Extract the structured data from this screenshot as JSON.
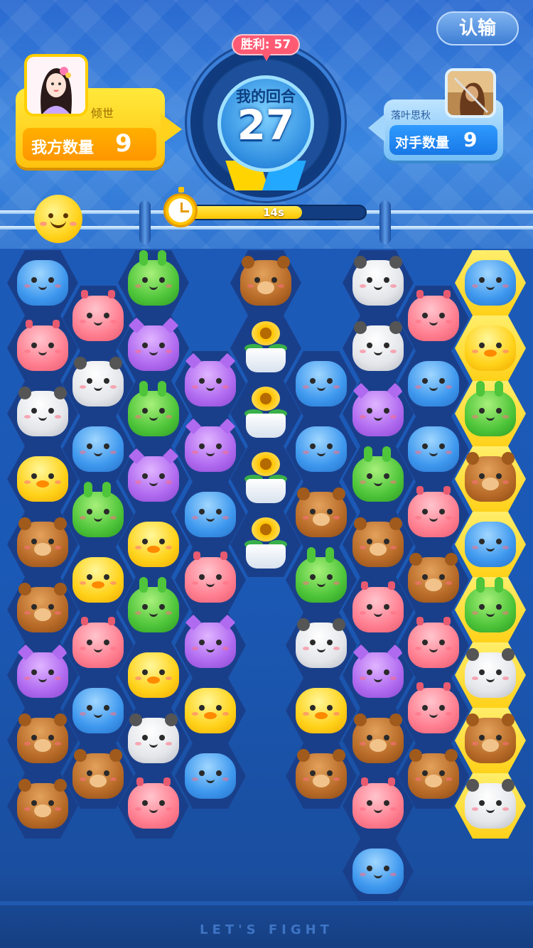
{
  "header": {
    "surrender_label": "认输",
    "win_badge": "胜利: 57",
    "turn_label": "我的回合",
    "turn_number": "27"
  },
  "players": {
    "me": {
      "name": "倾世",
      "count_label": "我方数量",
      "count": "9",
      "avatar_icon": "player-avatar-girl-icon"
    },
    "opponent": {
      "name": "落叶思秋",
      "count_label": "对手数量",
      "count": "9",
      "avatar_icon": "opponent-avatar-warrior-icon"
    }
  },
  "timer": {
    "text": "14s",
    "fraction": 0.66
  },
  "mood_icon": "smiley-face-icon",
  "footer": {
    "text": "LET'S FIGHT"
  },
  "colors": {
    "player_accent": "#ffd21e",
    "opponent_accent": "#22a8ff",
    "board_bg": "#1a3f8a",
    "highlight": "#ffd11a"
  },
  "board": {
    "legend": {
      "B": "blue-hippo",
      "P": "pink-deer",
      "W": "white-panda",
      "Y": "yellow-chick",
      "R": "brown-bear",
      "G": "green-bunny",
      "V": "purple-cat",
      "F": "sunflower-pot"
    },
    "columns": [
      {
        "pieces": [
          "B",
          "P",
          "W",
          "Y",
          "R",
          "R",
          "V",
          "R",
          "R"
        ],
        "highlight": false
      },
      {
        "pieces": [
          "P",
          "W",
          "B",
          "G",
          "Y",
          "P",
          "B",
          "R"
        ],
        "highlight": false
      },
      {
        "pieces": [
          "G",
          "V",
          "G",
          "V",
          "Y",
          "G",
          "Y",
          "W",
          "P"
        ],
        "highlight": false
      },
      {
        "pieces": [
          "V",
          "V",
          "B",
          "P",
          "V",
          "Y",
          "B"
        ],
        "highlight": false
      },
      {
        "pieces": [
          "R",
          "F",
          "F",
          "F",
          "F"
        ],
        "highlight": false
      },
      {
        "pieces": [
          "B",
          "B",
          "R",
          "G",
          "W",
          "Y",
          "R"
        ],
        "highlight": false
      },
      {
        "pieces": [
          "W",
          "W",
          "V",
          "G",
          "R",
          "P",
          "V",
          "R",
          "P",
          "B"
        ],
        "highlight": false
      },
      {
        "pieces": [
          "P",
          "B",
          "B",
          "P",
          "R",
          "P",
          "P",
          "R"
        ],
        "highlight": false
      },
      {
        "pieces": [
          "B",
          "Y",
          "G",
          "R",
          "B",
          "G",
          "W",
          "R",
          "W"
        ],
        "highlight": true
      }
    ]
  }
}
